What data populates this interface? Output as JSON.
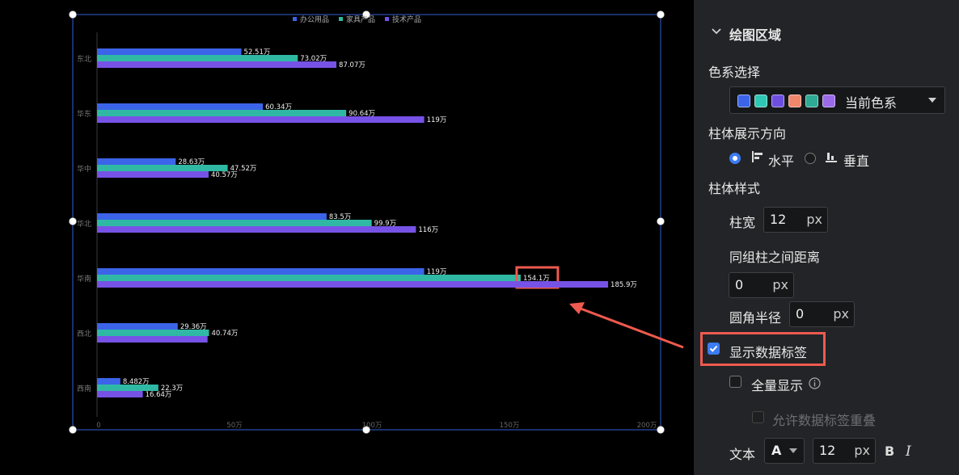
{
  "chart_data": {
    "type": "bar",
    "orientation": "horizontal",
    "categories": [
      "东北",
      "华东",
      "华中",
      "华北",
      "华南",
      "西北",
      "西南"
    ],
    "series": [
      {
        "name": "办公用品",
        "color": "#3b64e8",
        "values": [
          52.51,
          60.34,
          28.63,
          83.5,
          119,
          29.36,
          8.482
        ],
        "labels": [
          "52.51万",
          "60.34万",
          "28.63万",
          "83.5万",
          "119万",
          "29.36万",
          "8.482万"
        ]
      },
      {
        "name": "家具产品",
        "color": "#2fb9a4",
        "values": [
          73.02,
          90.64,
          47.52,
          99.9,
          154.1,
          40.74,
          22.3
        ],
        "labels": [
          "73.02万",
          "90.64万",
          "47.52万",
          "99.9万",
          "154.1万",
          "40.74万",
          "22.3万"
        ]
      },
      {
        "name": "技术产品",
        "color": "#7752e6",
        "values": [
          87.07,
          119,
          40.57,
          116,
          185.9,
          40.2,
          16.64
        ],
        "labels": [
          "87.07万",
          "119万",
          "40.57万",
          "116万",
          "185.9万",
          "",
          "16.64万"
        ]
      }
    ],
    "x_ticks": [
      0,
      50,
      100,
      150,
      200
    ],
    "x_tick_labels": [
      "0",
      "50万",
      "100万",
      "150万",
      "200万"
    ],
    "xlim": [
      0,
      200
    ],
    "legend_position": "top",
    "grid": false,
    "highlighted_label": "154.1万"
  },
  "panel": {
    "section_title": "绘图区域",
    "color_scheme_label": "色系选择",
    "color_scheme_value": "当前色系",
    "color_scheme_swatches": [
      "#3b64e8",
      "#2fc7b4",
      "#6d4fe0",
      "#f0866c",
      "#2fa894",
      "#9b6ae8"
    ],
    "direction_label": "柱体展示方向",
    "direction_horizontal": "水平",
    "direction_vertical": "垂直",
    "bar_style_label": "柱体样式",
    "bar_width_label": "柱宽",
    "bar_width_value": "12",
    "group_gap_label": "同组柱之间距离",
    "group_gap_value": "0",
    "corner_radius_label": "圆角半径",
    "corner_radius_value": "0",
    "unit_px": "px",
    "show_labels_label": "显示数据标签",
    "show_all_label": "全量显示",
    "allow_overlap_label": "允许数据标签重叠",
    "text_label": "文本",
    "font_glyph": "A",
    "font_size_value": "12",
    "bold_glyph": "B",
    "italic_glyph": "I"
  }
}
